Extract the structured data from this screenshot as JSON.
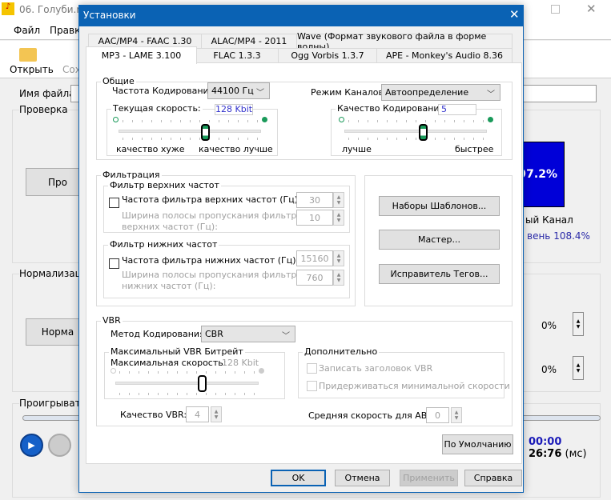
{
  "app": {
    "title": "06. Голуби.mp",
    "menu": [
      "Файл",
      "Правка"
    ],
    "toolbar": [
      "Открыть",
      "Сох"
    ],
    "file_label": "Имя файла:",
    "groups": [
      "Проверка",
      "Нормализация",
      "Проигрыватель"
    ],
    "buttons": [
      "Про",
      "Норма"
    ],
    "meter_value": "97.2%",
    "channel_label": "ый Канал",
    "level_label": "вень 108.4%",
    "spin1": "0%",
    "spin2": "0%",
    "time1": "00:00",
    "time2": "26:76",
    "time_unit": "(мс)",
    "meter_color": "#0000d8"
  },
  "dialog": {
    "title": "Установки",
    "tabs_row1": [
      "AAC/MP4 - FAAC 1.30",
      "ALAC/MP4 - 2011",
      "Wave (Формат звукового файла в форме волны)"
    ],
    "tabs_row2": [
      "MP3 - LAME 3.100",
      "FLAC 1.3.3",
      "Ogg Vorbis 1.3.7",
      "APE - Monkey's Audio 8.36"
    ],
    "active_tab": "MP3 - LAME 3.100",
    "general": {
      "title": "Общие",
      "freq_label": "Частота Кодирования:",
      "freq_value": "44100 Гц",
      "channel_label": "Режим Каналов:",
      "channel_value": "Автоопределение",
      "bitrate_label": "Текущая скорость:",
      "bitrate_value": "128 Kbit",
      "bitrate_left": "качество хуже",
      "bitrate_right": "качество лучше",
      "quality_label": "Качество Кодирования:",
      "quality_value": "5",
      "quality_left": "лучше",
      "quality_right": "быстрее"
    },
    "filter": {
      "title": "Фильтрация",
      "high_title": "Фильтр верхних частот",
      "high_freq_label": "Частота фильтра верхних частот (Гц):",
      "high_freq_value": "30",
      "high_width_label1": "Ширина полосы пропускания фильтра",
      "high_width_label2": "верхних частот (Гц):",
      "high_width_value": "10",
      "low_title": "Фильтр нижних частот",
      "low_freq_label": "Частота фильтра нижних частот (Гц):",
      "low_freq_value": "15160",
      "low_width_label1": "Ширина полосы пропускания фильтра",
      "low_width_label2": "нижних частот (Гц):",
      "low_width_value": "760"
    },
    "side_buttons": [
      "Наборы Шаблонов...",
      "Мастер...",
      "Исправитель Тегов..."
    ],
    "vbr": {
      "title": "VBR",
      "method_label": "Метод Кодирования:",
      "method_value": "CBR",
      "max_title": "Максимальный VBR Битрейт",
      "max_label": "Максимальная скорость:",
      "max_value": "128 Kbit",
      "extra_title": "Дополнительно",
      "write_header": "Записать заголовок VBR",
      "min_rate": "Придерживаться минимальной скорости",
      "quality_label": "Качество VBR:",
      "quality_value": "4",
      "abr_label": "Средняя скорость для ABR:",
      "abr_value": "0"
    },
    "default_button": "По Умолчанию",
    "ok": "OK",
    "cancel": "Отмена",
    "apply": "Применить",
    "help": "Справка",
    "accent": "#0a62b4"
  }
}
